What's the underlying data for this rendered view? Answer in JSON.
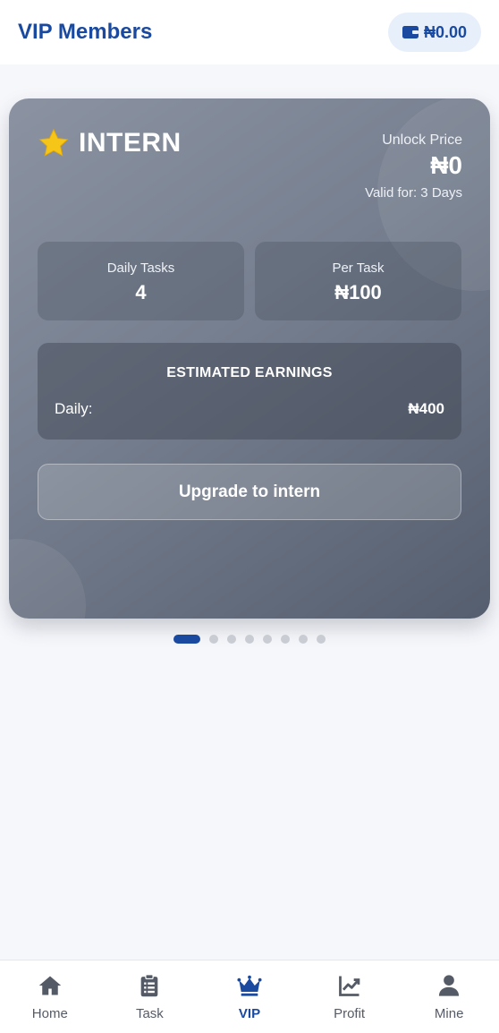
{
  "header": {
    "title": "VIP Members",
    "wallet_balance": "₦0.00",
    "wallet_icon": "wallet-icon"
  },
  "vip_card": {
    "tier_icon": "star-icon",
    "tier_name": "INTERN",
    "unlock_label": "Unlock Price",
    "unlock_price": "₦0",
    "valid_text": "Valid for: 3 Days",
    "daily_tasks_label": "Daily Tasks",
    "daily_tasks_value": "4",
    "per_task_label": "Per Task",
    "per_task_value": "₦100",
    "earnings_title": "ESTIMATED EARNINGS",
    "daily_label": "Daily:",
    "daily_value": "₦400",
    "upgrade_label": "Upgrade to intern"
  },
  "pagination": {
    "total": 8,
    "active_index": 0
  },
  "bottom_nav": {
    "items": [
      {
        "label": "Home",
        "icon": "home-icon",
        "active": false
      },
      {
        "label": "Task",
        "icon": "clipboard-icon",
        "active": false
      },
      {
        "label": "VIP",
        "icon": "crown-icon",
        "active": true
      },
      {
        "label": "Profit",
        "icon": "chart-line-icon",
        "active": false
      },
      {
        "label": "Mine",
        "icon": "user-icon",
        "active": false
      }
    ]
  },
  "colors": {
    "brand": "#1a4aa0",
    "star": "#f5c518",
    "nav_inactive": "#555b66"
  }
}
